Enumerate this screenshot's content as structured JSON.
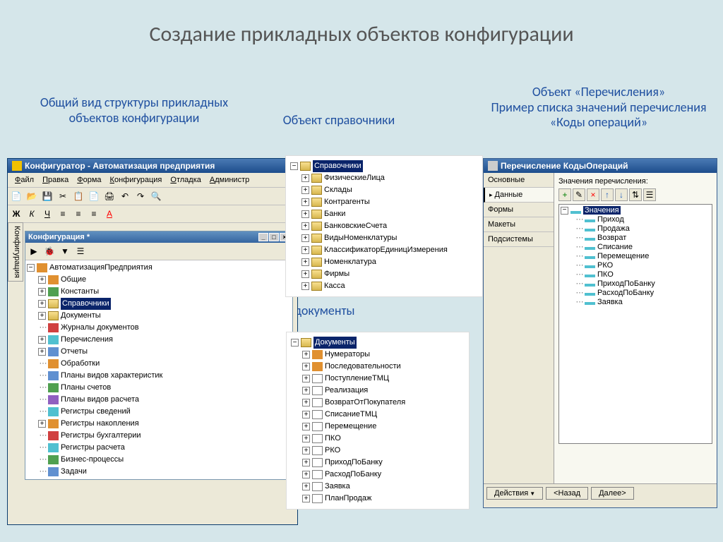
{
  "slide": {
    "title": "Создание прикладных объектов конфигурации"
  },
  "captions": {
    "c1": "Общий вид структуры прикладных объектов конфигурации",
    "c2": "Объект справочники",
    "c3": "Объект «Перечисления»\nПример списка значений перечисления «Коды операций»",
    "c4": "Объект документы"
  },
  "configurator": {
    "title": "Конфигуратор - Автоматизация предприятия",
    "menu": [
      "Файл",
      "Правка",
      "Форма",
      "Конфигурация",
      "Отладка",
      "Администр"
    ],
    "vtab": "Конфигурация",
    "subtitle": "Конфигурация *",
    "root": "АвтоматизацияПредприятия",
    "items": [
      {
        "label": "Общие",
        "cls": "orange",
        "exp": "+"
      },
      {
        "label": "Константы",
        "cls": "green",
        "exp": "+"
      },
      {
        "label": "Справочники",
        "cls": "fold",
        "exp": "+",
        "sel": true
      },
      {
        "label": "Документы",
        "cls": "fold",
        "exp": "+"
      },
      {
        "label": "Журналы документов",
        "cls": "red",
        "exp": ""
      },
      {
        "label": "Перечисления",
        "cls": "cyan",
        "exp": "+"
      },
      {
        "label": "Отчеты",
        "cls": "blue",
        "exp": "+"
      },
      {
        "label": "Обработки",
        "cls": "orange",
        "exp": ""
      },
      {
        "label": "Планы видов характеристик",
        "cls": "blue",
        "exp": ""
      },
      {
        "label": "Планы счетов",
        "cls": "green",
        "exp": ""
      },
      {
        "label": "Планы видов расчета",
        "cls": "purple",
        "exp": ""
      },
      {
        "label": "Регистры сведений",
        "cls": "cyan",
        "exp": ""
      },
      {
        "label": "Регистры накопления",
        "cls": "orange",
        "exp": "+"
      },
      {
        "label": "Регистры бухгалтерии",
        "cls": "red",
        "exp": ""
      },
      {
        "label": "Регистры расчета",
        "cls": "cyan",
        "exp": ""
      },
      {
        "label": "Бизнес-процессы",
        "cls": "green",
        "exp": ""
      },
      {
        "label": "Задачи",
        "cls": "blue",
        "exp": ""
      }
    ]
  },
  "spravochniki": {
    "root": "Справочники",
    "items": [
      "ФизическиеЛица",
      "Склады",
      "Контрагенты",
      "Банки",
      "БанковскиеСчета",
      "ВидыНоменклатуры",
      "КлассификаторЕдиницИзмерения",
      "Номенклатура",
      "Фирмы",
      "Касса"
    ]
  },
  "documents": {
    "root": "Документы",
    "items": [
      "Нумераторы",
      "Последовательности",
      "ПоступлениеТМЦ",
      "Реализация",
      "ВозвратОтПокупателя",
      "СписаниеТМЦ",
      "Перемещение",
      "ПКО",
      "РКО",
      "ПриходПоБанку",
      "РасходПоБанку",
      "Заявка",
      "ПланПродаж"
    ]
  },
  "enum": {
    "title": "Перечисление КодыОпераций",
    "tabs": [
      "Основные",
      "Данные",
      "Формы",
      "Макеты",
      "Подсистемы"
    ],
    "label": "Значения перечисления:",
    "root": "Значения",
    "values": [
      "Приход",
      "Продажа",
      "Возврат",
      "Списание",
      "Перемещение",
      "РКО",
      "ПКО",
      "ПриходПоБанку",
      "РасходПоБанку",
      "Заявка"
    ],
    "buttons": {
      "actions": "Действия",
      "back": "<Назад",
      "next": "Далее>"
    }
  }
}
